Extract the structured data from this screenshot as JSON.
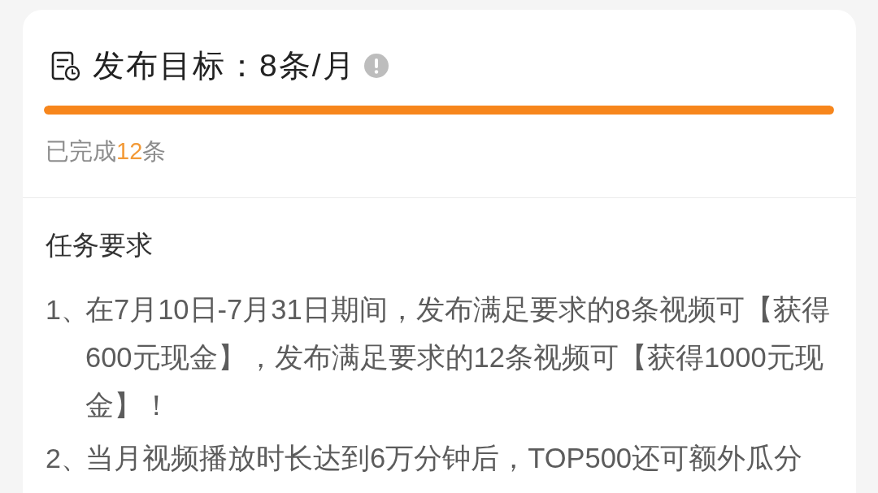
{
  "goal_card": {
    "title": "发布目标：8条/月",
    "progress": {
      "level": 1,
      "completed_prefix": "已完成",
      "completed_count": "12",
      "completed_suffix": "条"
    },
    "requirements": {
      "heading": "任务要求",
      "items": [
        {
          "number": "1、",
          "text": "在7月10日-7月31日期间，发布满足要求的8条视频可【获得600元现金】，发布满足要求的12条视频可【获得1000元现金】！"
        },
        {
          "number": "2、",
          "text": "当月视频播放时长达到6万分钟后，TOP500还可额外瓜分"
        }
      ]
    }
  }
}
